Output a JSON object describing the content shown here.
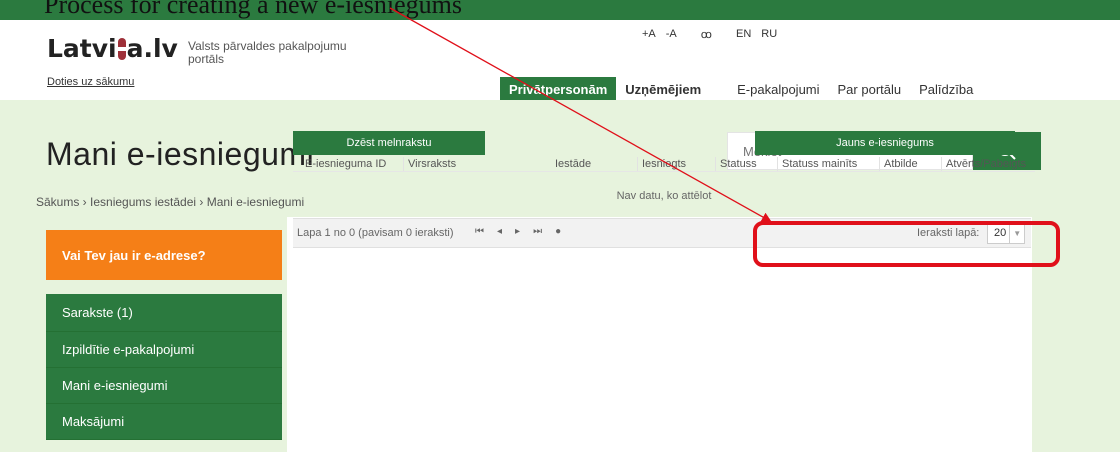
{
  "top_banner": {
    "text": "Process for creating a new e-iesniegums"
  },
  "header": {
    "logo_text_a": "Latvi",
    "logo_text_b": "a.lv",
    "tagline": "Valsts pārvaldes pakalpojumu portāls",
    "home_link": "Doties uz sākumu",
    "font_increase": "+A",
    "font_decrease": "-A",
    "accessibility": "ꝏ",
    "lang_en": "EN",
    "lang_ru": "RU"
  },
  "nav": {
    "items": [
      {
        "label": "Privātpersonām"
      },
      {
        "label": "Uzņēmējiem"
      },
      {
        "label": "E-pakalpojumi"
      },
      {
        "label": "Par portālu"
      },
      {
        "label": "Palīdzība"
      }
    ]
  },
  "main": {
    "title": "Mani e-iesniegumi",
    "search_placeholder": "Meklēt",
    "breadcrumb": "Sākums › Iesniegums iestādei › Mani e-iesniegumi"
  },
  "sidebar": {
    "adrese": "Vai Tev jau ir e-adrese?",
    "items": [
      {
        "label": "Sarakste (1)"
      },
      {
        "label": "Izpildītie e-pakalpojumi"
      },
      {
        "label": "Mani e-iesniegumi"
      },
      {
        "label": "Maksājumi"
      }
    ]
  },
  "actions": {
    "delete_draft": "Dzēst melnrakstu",
    "new_submission": "Jauns e-iesniegums"
  },
  "table": {
    "columns": [
      "E-iesnieguma ID",
      "Virsraksts",
      "Iestāde",
      "Iesniegts",
      "Statuss",
      "Statuss mainīts",
      "Atbilde",
      "Atvērts/Pabeigts"
    ],
    "empty_text": "Nav datu, ko attēlot"
  },
  "pager": {
    "info": "Lapa 1 no 0 (pavisam 0 ieraksti)",
    "per_page_label": "Ieraksti lapā:",
    "per_page_value": "20",
    "first": "⏮",
    "prev": "◂",
    "next": "▸",
    "last": "⏭",
    "all": "●"
  },
  "colors": {
    "brand_green": "#2b7a3f",
    "accent_orange": "#f57f17",
    "annotation_red": "#e0101a",
    "background": "#e7f3dd"
  }
}
